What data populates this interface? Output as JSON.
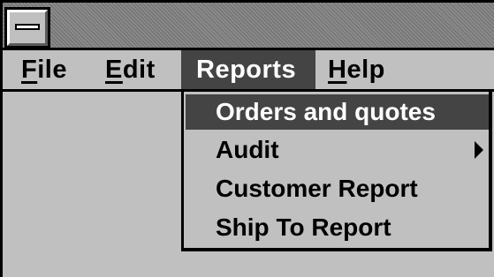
{
  "menubar": {
    "file": {
      "mnemonic": "F",
      "rest": "ile"
    },
    "edit": {
      "mnemonic": "E",
      "rest": "dit"
    },
    "reports": {
      "label": "Reports"
    },
    "help": {
      "mnemonic": "H",
      "rest": "elp"
    }
  },
  "reports_menu": {
    "items": [
      {
        "label": "Orders and quotes",
        "selected": true
      },
      {
        "label": "Audit",
        "submenu_icon": "right-triangle-arrow-icon"
      },
      {
        "label": "Customer Report"
      },
      {
        "label": "Ship To Report"
      }
    ]
  },
  "colors": {
    "face": "#c0c0c0",
    "highlight": "#444444",
    "highlight_text": "#ffffff",
    "text": "#000000"
  }
}
